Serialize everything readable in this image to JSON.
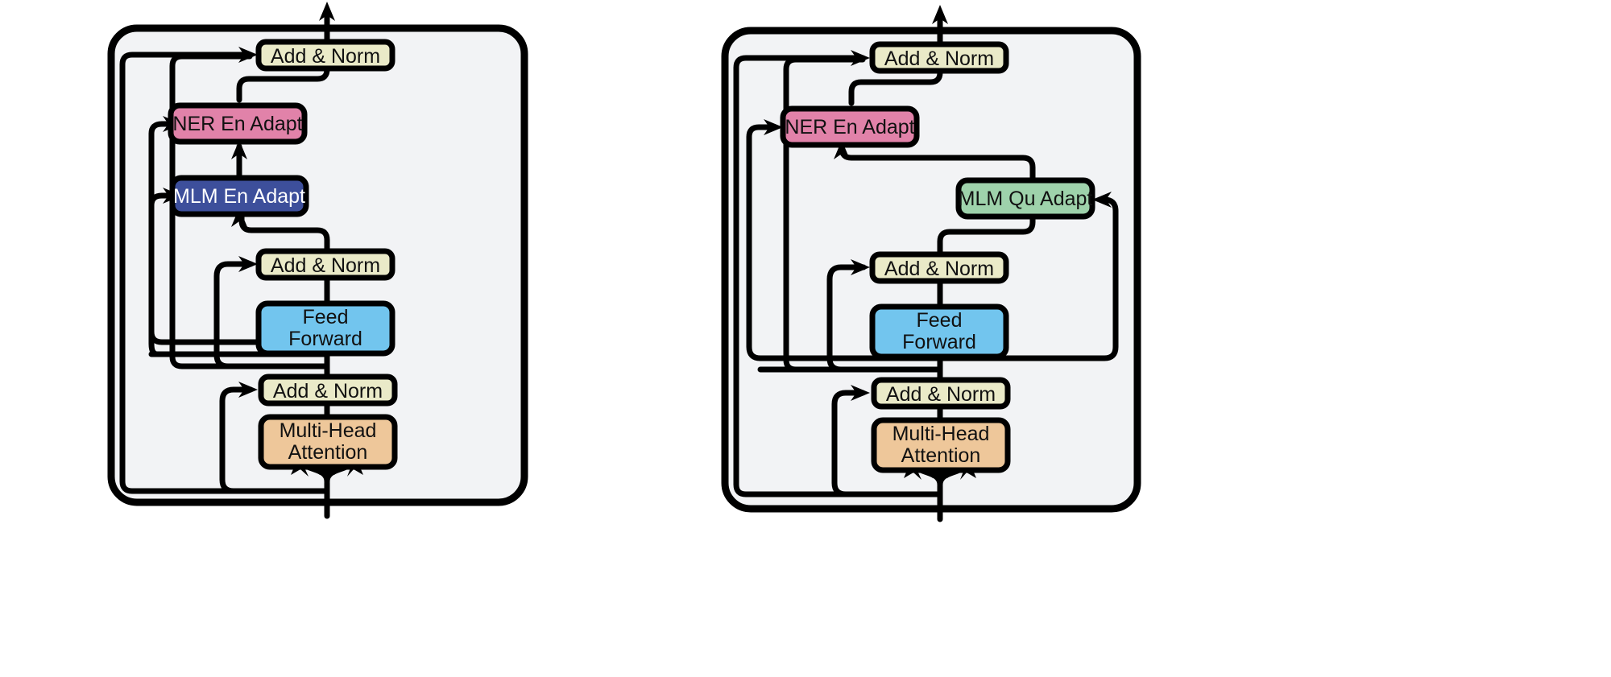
{
  "figure": {
    "type": "diagram",
    "kind": "transformer-layer-adapter-architecture",
    "background_color": "#ffffff",
    "panel_fill": "#f2f3f5",
    "panel_stroke": "#000000",
    "stroke_color": "#000000"
  },
  "palette": {
    "add_norm": "#eaeac8",
    "ner_adapter": "#e182a9",
    "mlm_en_adapter": "#3d4f9b",
    "mlm_qu_adapter": "#9ed2ab",
    "feed_forward": "#72c5ee",
    "attention": "#eec79a",
    "text_dark": "#111111",
    "text_light": "#ffffff"
  },
  "panels": [
    {
      "id": "left",
      "name": "english-encoder-layer",
      "nodes": [
        {
          "id": "l-addnorm-top",
          "label": "Add & Norm",
          "color_key": "add_norm",
          "text_style": "dark",
          "lines": [
            "Add & Norm"
          ]
        },
        {
          "id": "l-ner-adapt",
          "label": "NER En Adapt",
          "color_key": "ner_adapter",
          "text_style": "dark",
          "lines": [
            "NER En Adapt"
          ]
        },
        {
          "id": "l-mlm-adapt",
          "label": "MLM En Adapt",
          "color_key": "mlm_en_adapter",
          "text_style": "light",
          "lines": [
            "MLM En Adapt"
          ]
        },
        {
          "id": "l-addnorm-mid",
          "label": "Add & Norm",
          "color_key": "add_norm",
          "text_style": "dark",
          "lines": [
            "Add & Norm"
          ]
        },
        {
          "id": "l-feedforward",
          "label": "Feed Forward",
          "color_key": "feed_forward",
          "text_style": "dark",
          "lines": [
            "Feed",
            "Forward"
          ]
        },
        {
          "id": "l-addnorm-bot",
          "label": "Add & Norm",
          "color_key": "add_norm",
          "text_style": "dark",
          "lines": [
            "Add & Norm"
          ]
        },
        {
          "id": "l-attention",
          "label": "Multi-Head Attention",
          "color_key": "attention",
          "text_style": "dark",
          "lines": [
            "Multi-Head",
            "Attention"
          ]
        }
      ]
    },
    {
      "id": "right",
      "name": "quechua-encoder-layer",
      "nodes": [
        {
          "id": "r-addnorm-top",
          "label": "Add & Norm",
          "color_key": "add_norm",
          "text_style": "dark",
          "lines": [
            "Add & Norm"
          ]
        },
        {
          "id": "r-ner-adapt",
          "label": "NER En Adapt",
          "color_key": "ner_adapter",
          "text_style": "dark",
          "lines": [
            "NER En Adapt"
          ]
        },
        {
          "id": "r-mlm-adapt",
          "label": "MLM Qu Adapt",
          "color_key": "mlm_qu_adapter",
          "text_style": "dark",
          "lines": [
            "MLM Qu Adapt"
          ]
        },
        {
          "id": "r-addnorm-mid",
          "label": "Add & Norm",
          "color_key": "add_norm",
          "text_style": "dark",
          "lines": [
            "Add & Norm"
          ]
        },
        {
          "id": "r-feedforward",
          "label": "Feed Forward",
          "color_key": "feed_forward",
          "text_style": "dark",
          "lines": [
            "Feed",
            "Forward"
          ]
        },
        {
          "id": "r-addnorm-bot",
          "label": "Add & Norm",
          "color_key": "add_norm",
          "text_style": "dark",
          "lines": [
            "Add & Norm"
          ]
        },
        {
          "id": "r-attention",
          "label": "Multi-Head Attention",
          "color_key": "attention",
          "text_style": "dark",
          "lines": [
            "Multi-Head",
            "Attention"
          ]
        }
      ]
    }
  ],
  "labels": {
    "add_norm": "Add & Norm",
    "ner_en_adapt": "NER En Adapt",
    "mlm_en_adapt": "MLM En Adapt",
    "mlm_qu_adapt": "MLM Qu Adapt",
    "feed": "Feed",
    "forward": "Forward",
    "multi_head": "Multi-Head",
    "attention": "Attention"
  }
}
